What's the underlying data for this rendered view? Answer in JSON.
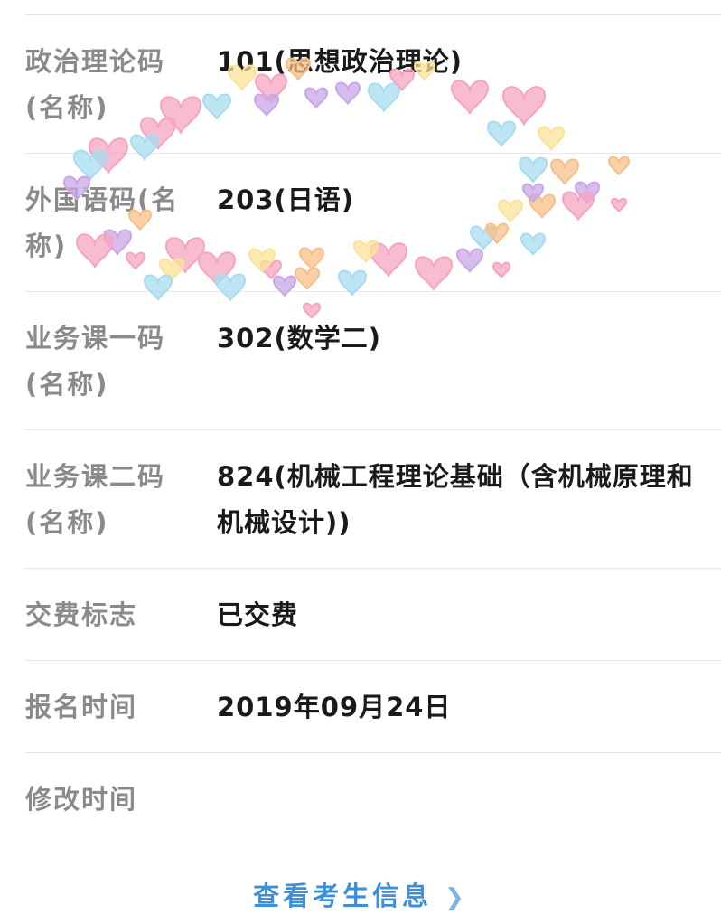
{
  "rows": [
    {
      "label": "政治理论码(名称)",
      "value": "101(思想政治理论)"
    },
    {
      "label": "外国语码(名称)",
      "value": "203(日语)"
    },
    {
      "label": "业务课一码(名称)",
      "value": "302(数学二)"
    },
    {
      "label": "业务课二码(名称)",
      "value": "824(机械工程理论基础（含机械原理和机械设计))"
    },
    {
      "label": "交费标志",
      "value": "已交费"
    },
    {
      "label": "报名时间",
      "value": "2019年09月24日"
    },
    {
      "label": "修改时间",
      "value": ""
    }
  ],
  "footer": {
    "link_label": "查看考生信息",
    "chevron_icon": "chevron-right-icon"
  },
  "colors": {
    "label": "#8a8a8a",
    "value": "#1a1a1a",
    "divider": "#e6e6e6",
    "link": "#3d8fd9",
    "hearts": [
      "#f6a5c0",
      "#a8dcf0",
      "#c9a7e8",
      "#f7c08a",
      "#fbe39a"
    ]
  }
}
